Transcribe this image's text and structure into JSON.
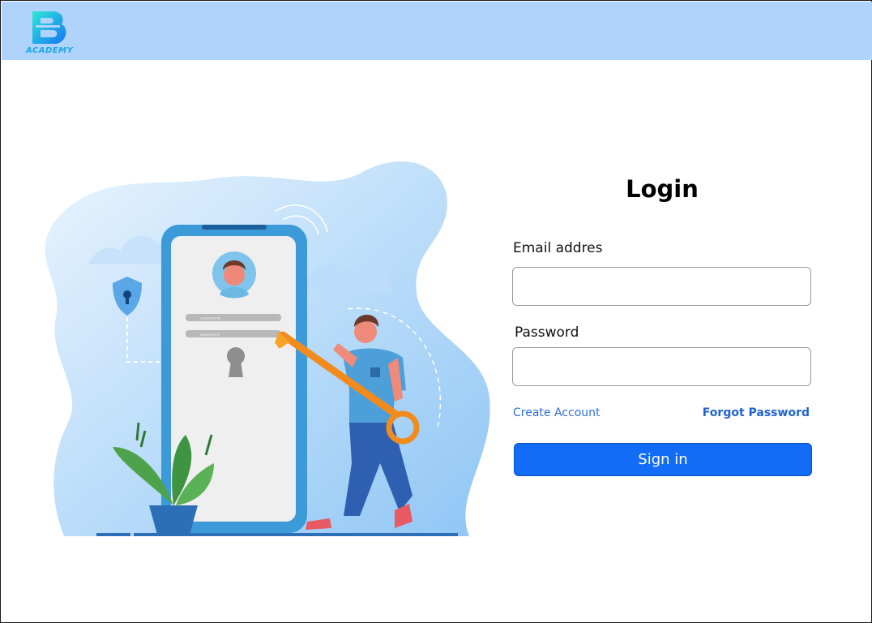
{
  "header": {
    "logo_text": "ACADEMY"
  },
  "illustration": {
    "username_placeholder": "username",
    "password_placeholder": "password"
  },
  "login": {
    "title": "Login",
    "email_label": "Email addres",
    "email_value": "",
    "password_label": "Password",
    "password_value": "",
    "create_account": "Create Account",
    "forgot_password": "Forgot Password",
    "sign_in": "Sign in"
  },
  "colors": {
    "header_bg": "#b0d3fc",
    "primary_button": "#136cf6",
    "link": "#2e6ed6"
  }
}
